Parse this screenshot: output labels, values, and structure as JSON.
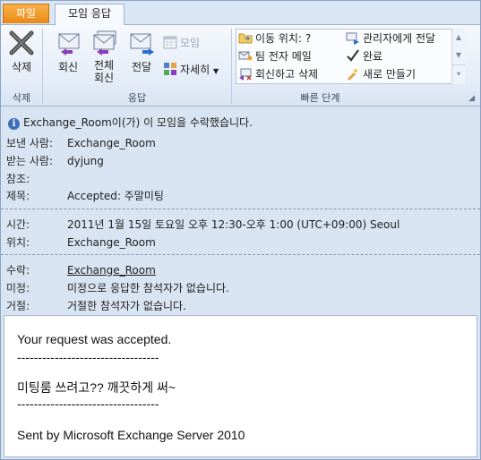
{
  "tabs": {
    "file": "파일",
    "meeting_response": "모임 응답"
  },
  "ribbon": {
    "delete_group": {
      "button": "삭제",
      "label": "삭제"
    },
    "respond_group": {
      "reply": "회신",
      "reply_all_line1": "전체",
      "reply_all_line2": "회신",
      "forward": "전달",
      "meeting": "모임",
      "more": "자세히",
      "label": "응답"
    },
    "quick_steps": {
      "move_to": "이동 위치: ?",
      "team_email": "팀 전자 메일",
      "reply_delete": "회신하고 삭제",
      "to_manager": "관리자에게 전달",
      "done": "완료",
      "create_new": "새로 만들기",
      "label": "빠른 단계"
    }
  },
  "message": {
    "info": "Exchange_Room이(가) 이 모임을 수락했습니다.",
    "from_label": "보낸 사람:",
    "from": "Exchange_Room",
    "to_label": "받는 사람:",
    "to": "dyjung",
    "cc_label": "참조:",
    "cc": "",
    "subject_label": "제목:",
    "subject": "Accepted: 주말미팅",
    "when_label": "시간:",
    "when": "2011년 1월 15일 토요일 오후 12:30-오후 1:00 (UTC+09:00) Seoul",
    "where_label": "위치:",
    "where": "Exchange_Room",
    "accepted_label": "수락:",
    "accepted": "Exchange_Room",
    "tentative_label": "미정:",
    "tentative": "미정으로 응답한 참석자가 없습니다.",
    "declined_label": "거절:",
    "declined": "거절한 참석자가 없습니다."
  },
  "body": {
    "line1": "Your request was accepted.",
    "sep1": "----------------------------------",
    "line2": "미팅룸 쓰려고?? 깨끗하게 써~",
    "sep2": "----------------------------------",
    "line3": "Sent by Microsoft Exchange Server 2010"
  }
}
